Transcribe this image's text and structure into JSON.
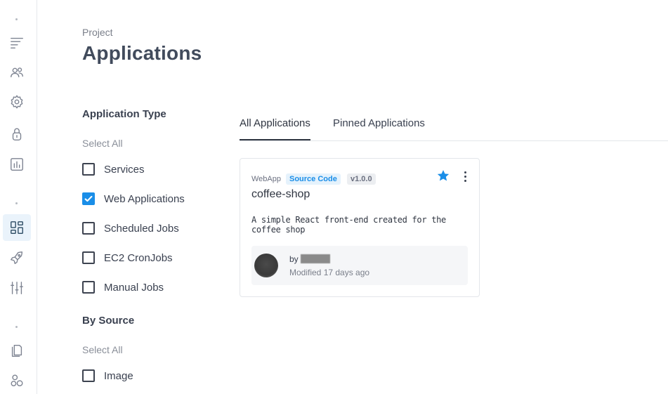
{
  "sidebar": {
    "icons": [
      "menu-lines-icon",
      "users-icon",
      "gear-icon",
      "lock-icon",
      "bar-chart-icon",
      "dashboard-icon",
      "rocket-icon",
      "sliders-icon",
      "documents-icon",
      "hexagons-icon"
    ],
    "active": "dashboard-icon"
  },
  "header": {
    "subtitle": "Project",
    "title": "Applications"
  },
  "filters": {
    "app_type": {
      "heading": "Application Type",
      "select_all": "Select All",
      "options": [
        {
          "label": "Services",
          "checked": false
        },
        {
          "label": "Web Applications",
          "checked": true
        },
        {
          "label": "Scheduled Jobs",
          "checked": false
        },
        {
          "label": "EC2 CronJobs",
          "checked": false
        },
        {
          "label": "Manual Jobs",
          "checked": false
        }
      ]
    },
    "by_source": {
      "heading": "By Source",
      "select_all": "Select All",
      "options": [
        {
          "label": "Image",
          "checked": false
        }
      ]
    }
  },
  "tabs": [
    {
      "label": "All Applications",
      "active": true
    },
    {
      "label": "Pinned Applications",
      "active": false
    }
  ],
  "card": {
    "type": "WebApp",
    "source_badge": "Source Code",
    "version_badge": "v1.0.0",
    "name": "coffee-shop",
    "description": "A simple React front-end created for the coffee shop",
    "by_label": "by",
    "modified": "Modified 17 days ago",
    "pinned": true
  },
  "colors": {
    "accent": "#1a8ee8",
    "title": "#414b5c",
    "active_nav_bg": "#eaf3fb"
  }
}
